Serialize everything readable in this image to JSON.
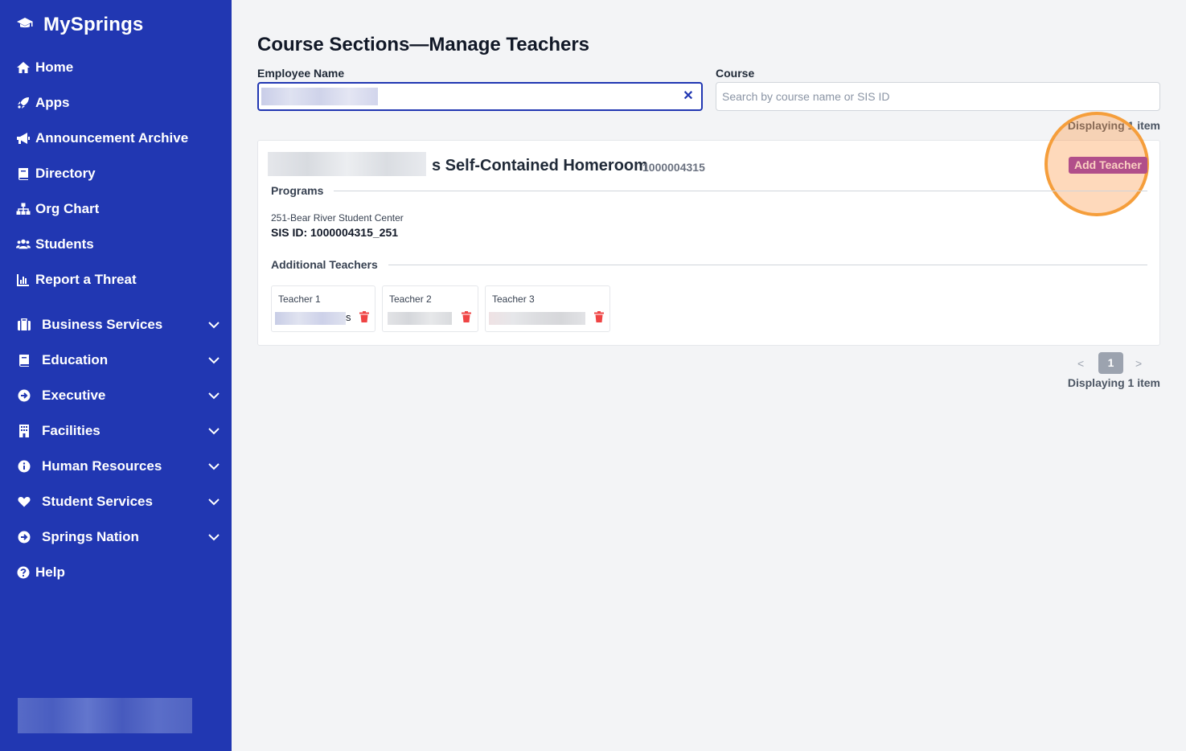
{
  "sidebar": {
    "brand": "MySprings",
    "top_items": [
      {
        "label": "Home",
        "icon": "home-icon"
      },
      {
        "label": "Apps",
        "icon": "rocket-icon"
      },
      {
        "label": "Announcement Archive",
        "icon": "megaphone-icon"
      },
      {
        "label": "Directory",
        "icon": "book-icon"
      },
      {
        "label": "Org Chart",
        "icon": "org-chart-icon"
      },
      {
        "label": "Students",
        "icon": "users-icon"
      },
      {
        "label": "Report a Threat",
        "icon": "chart-icon"
      }
    ],
    "groups": [
      {
        "label": "Business Services",
        "icon": "briefcase-icon"
      },
      {
        "label": "Education",
        "icon": "book-icon"
      },
      {
        "label": "Executive",
        "icon": "arrow-circle-icon"
      },
      {
        "label": "Facilities",
        "icon": "building-icon"
      },
      {
        "label": "Human Resources",
        "icon": "info-icon"
      },
      {
        "label": "Student Services",
        "icon": "heart-icon"
      },
      {
        "label": "Springs Nation",
        "icon": "arrow-circle-icon"
      }
    ],
    "help": {
      "label": "Help",
      "icon": "question-icon"
    },
    "colors": {
      "background": "#2137b2",
      "text": "#ffffff"
    }
  },
  "main": {
    "title": "Course Sections—Manage Teachers",
    "filters": {
      "employee_label": "Employee Name",
      "course_label": "Course",
      "course_placeholder": "Search by course name or SIS ID"
    },
    "displaying_top": "Displaying 1 item",
    "card": {
      "course_title": "s Self-Contained Homeroom",
      "course_id": "1000004315",
      "add_teacher_label": "Add Teacher",
      "programs_heading": "Programs",
      "program_name": "251-Bear River Student Center",
      "sis_id": "SIS ID: 1000004315_251",
      "additional_heading": "Additional Teachers",
      "teachers": [
        {
          "label": "Teacher 1",
          "suffix": "s"
        },
        {
          "label": "Teacher 2",
          "suffix": ""
        },
        {
          "label": "Teacher 3",
          "suffix": ""
        }
      ]
    },
    "pagination": {
      "prev": "<",
      "current": "1",
      "next": ">",
      "displaying": "Displaying 1 item"
    },
    "colors": {
      "accent": "#2137b2",
      "add_button": "#b14f8a",
      "highlight": "#f59e3b",
      "trash": "#ef4444"
    }
  }
}
